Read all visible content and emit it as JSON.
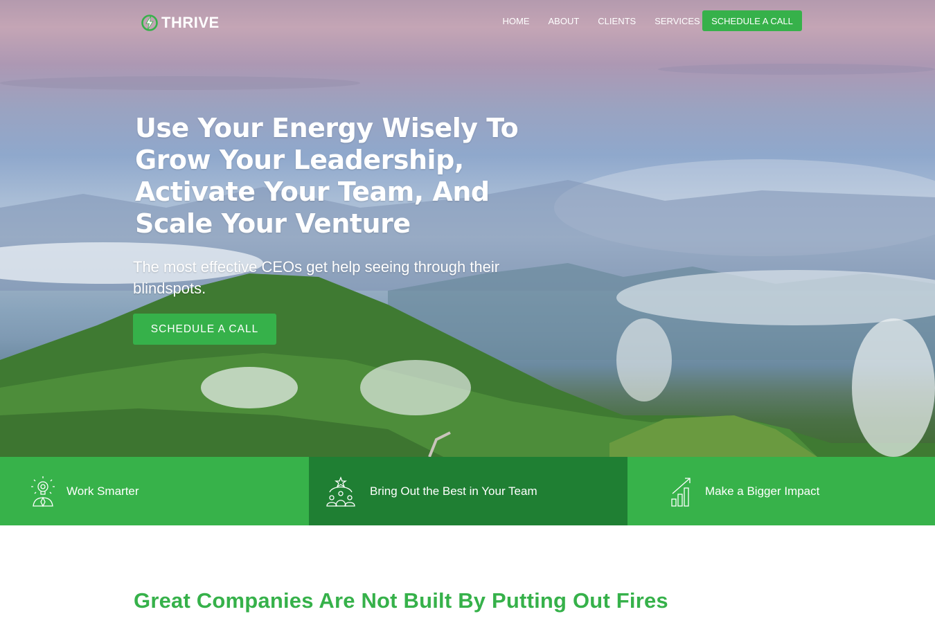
{
  "brand": {
    "name": "THRIVE",
    "logo_icon": "bolt-circle-icon"
  },
  "nav": {
    "items": [
      "HOME",
      "ABOUT",
      "CLIENTS",
      "SERVICES"
    ],
    "cta": "SCHEDULE A CALL"
  },
  "hero": {
    "headline": "Use Your Energy Wisely To Grow Your Leadership, Activate Your Team, And Scale Your Venture",
    "subtext": "The most effective CEOs get help seeing through their blindspots.",
    "cta": "SCHEDULE A CALL"
  },
  "features": [
    {
      "label": "Work Smarter",
      "icon": "lightbulb-person-icon"
    },
    {
      "label": "Bring Out the Best in Your Team",
      "icon": "team-star-icon"
    },
    {
      "label": "Make a Bigger Impact",
      "icon": "growth-chart-icon"
    }
  ],
  "section": {
    "title": "Great Companies Are Not Built By Putting Out Fires"
  },
  "colors": {
    "brand_green": "#36b14a",
    "dark_green": "#1f7f33"
  }
}
